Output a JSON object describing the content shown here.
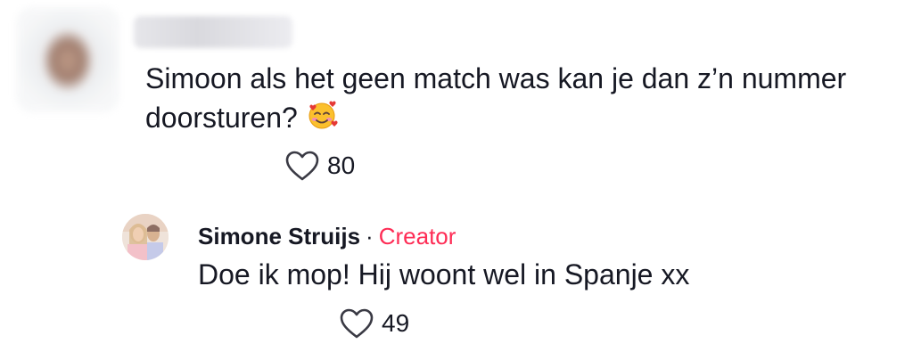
{
  "comment": {
    "text": "Simoon als het geen match was kan je dan z’n nummer doorsturen?",
    "emoji": "smiling-face-with-hearts",
    "likes": "80"
  },
  "reply": {
    "author": "Simone Struijs",
    "separator": "·",
    "badge": "Creator",
    "text": "Doe ik mop! Hij woont wel in Spanje xx",
    "likes": "49"
  },
  "colors": {
    "text": "#161823",
    "creator_badge": "#fe2c55",
    "background": "#ffffff"
  }
}
